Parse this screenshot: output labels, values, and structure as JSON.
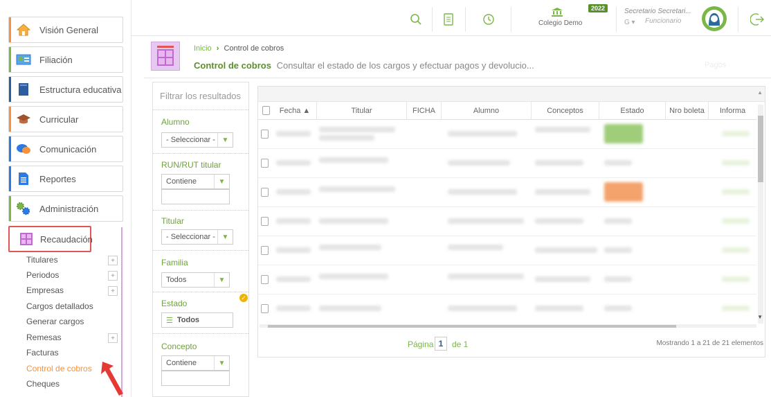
{
  "sidebar": {
    "items": [
      {
        "label": "Visión General",
        "icon": "home-icon",
        "color": "#f5923e"
      },
      {
        "label": "Filiación",
        "icon": "id-card-icon",
        "color": "#7ab648"
      },
      {
        "label": "Estructura educativa",
        "icon": "book-icon",
        "color": "#2c5d9e"
      },
      {
        "label": "Curricular",
        "icon": "graduation-cap-icon",
        "color": "#f5923e"
      },
      {
        "label": "Comunicación",
        "icon": "chat-icon",
        "color": "#2c7be5"
      },
      {
        "label": "Reportes",
        "icon": "document-icon",
        "color": "#2c7be5"
      },
      {
        "label": "Administración",
        "icon": "gears-icon",
        "color": "#7ab648"
      },
      {
        "label": "Recaudación",
        "icon": "calculator-icon",
        "color": "#c06ad0"
      }
    ],
    "sub_items": [
      {
        "label": "Titulares",
        "plus": "+"
      },
      {
        "label": "Periodos",
        "plus": "+"
      },
      {
        "label": "Empresas",
        "plus": "+"
      },
      {
        "label": "Cargos detallados",
        "plus": ""
      },
      {
        "label": "Generar cargos",
        "plus": ""
      },
      {
        "label": "Remesas",
        "plus": "+"
      },
      {
        "label": "Facturas",
        "plus": ""
      },
      {
        "label": "Control de cobros",
        "plus": "",
        "active": true
      },
      {
        "label": "Cheques",
        "plus": ""
      }
    ]
  },
  "topbar": {
    "school_name": "Colegio Demo",
    "year_badge": "2022",
    "user_name": "Secretario Secretari...",
    "user_role": "Funcionario",
    "user_prefix": "G ▾",
    "accent": "#7ab648"
  },
  "header": {
    "breadcrumb_home": "Inicio",
    "breadcrumb_sep": "›",
    "breadcrumb_current": "Control de cobros",
    "title": "Control de cobros",
    "description": "Consultar el estado de los cargos y efectuar pagos y devolucio...",
    "faint_right": "Pagos"
  },
  "filters": {
    "search_placeholder": "Filtrar los resultados",
    "alumno_label": "Alumno",
    "alumno_value": "- Seleccionar -",
    "run_label": "RUN/RUT titular",
    "run_value": "Contiene",
    "titular_label": "Titular",
    "titular_value": "- Seleccionar -",
    "familia_label": "Familia",
    "familia_value": "Todos",
    "estado_label": "Estado",
    "estado_value": "Todos",
    "concepto_label": "Concepto",
    "concepto_value": "Contiene"
  },
  "grid": {
    "columns": [
      "Fecha ▲",
      "Titular",
      "FICHA",
      "Alumno",
      "Conceptos",
      "Estado",
      "Nro boleta",
      "Informa"
    ],
    "pager_label": "Página",
    "page": "1",
    "page_of": "de 1",
    "summary": "Mostrando 1 a 21 de 21 elementos"
  }
}
